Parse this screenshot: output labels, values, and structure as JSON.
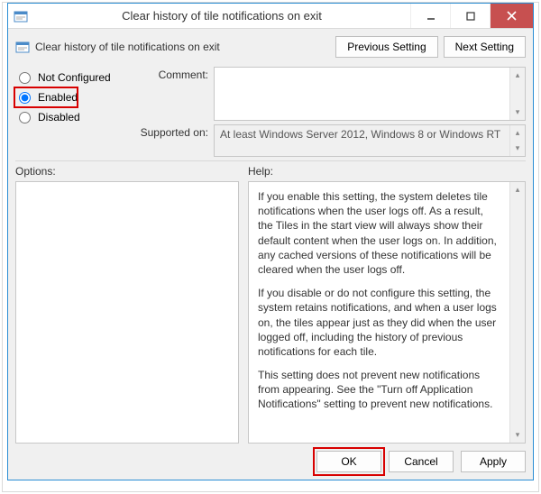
{
  "titlebar": {
    "title": "Clear history of tile notifications on exit"
  },
  "header": {
    "text": "Clear history of tile notifications on exit"
  },
  "nav": {
    "prev": "Previous Setting",
    "next": "Next Setting"
  },
  "radios": {
    "not_configured": "Not Configured",
    "enabled": "Enabled",
    "disabled": "Disabled",
    "selected": "enabled"
  },
  "form": {
    "comment_label": "Comment:",
    "comment_value": "",
    "supported_label": "Supported on:",
    "supported_value": "At least Windows Server 2012, Windows 8 or Windows RT"
  },
  "sections": {
    "options_label": "Options:",
    "help_label": "Help:"
  },
  "help": {
    "p1": "If you enable this setting, the system deletes tile notifications when the user logs off. As a result, the Tiles in the start view will always show their default content when the user logs on. In addition, any cached versions of these notifications will be cleared when the user logs off.",
    "p2": "If you disable or do not configure this setting, the system retains notifications, and when a user logs on, the tiles appear just as they did when the user logged off, including the history of previous notifications for each tile.",
    "p3": "This setting does not prevent new notifications from appearing. See the \"Turn off Application Notifications\" setting to prevent new notifications."
  },
  "buttons": {
    "ok": "OK",
    "cancel": "Cancel",
    "apply": "Apply"
  }
}
